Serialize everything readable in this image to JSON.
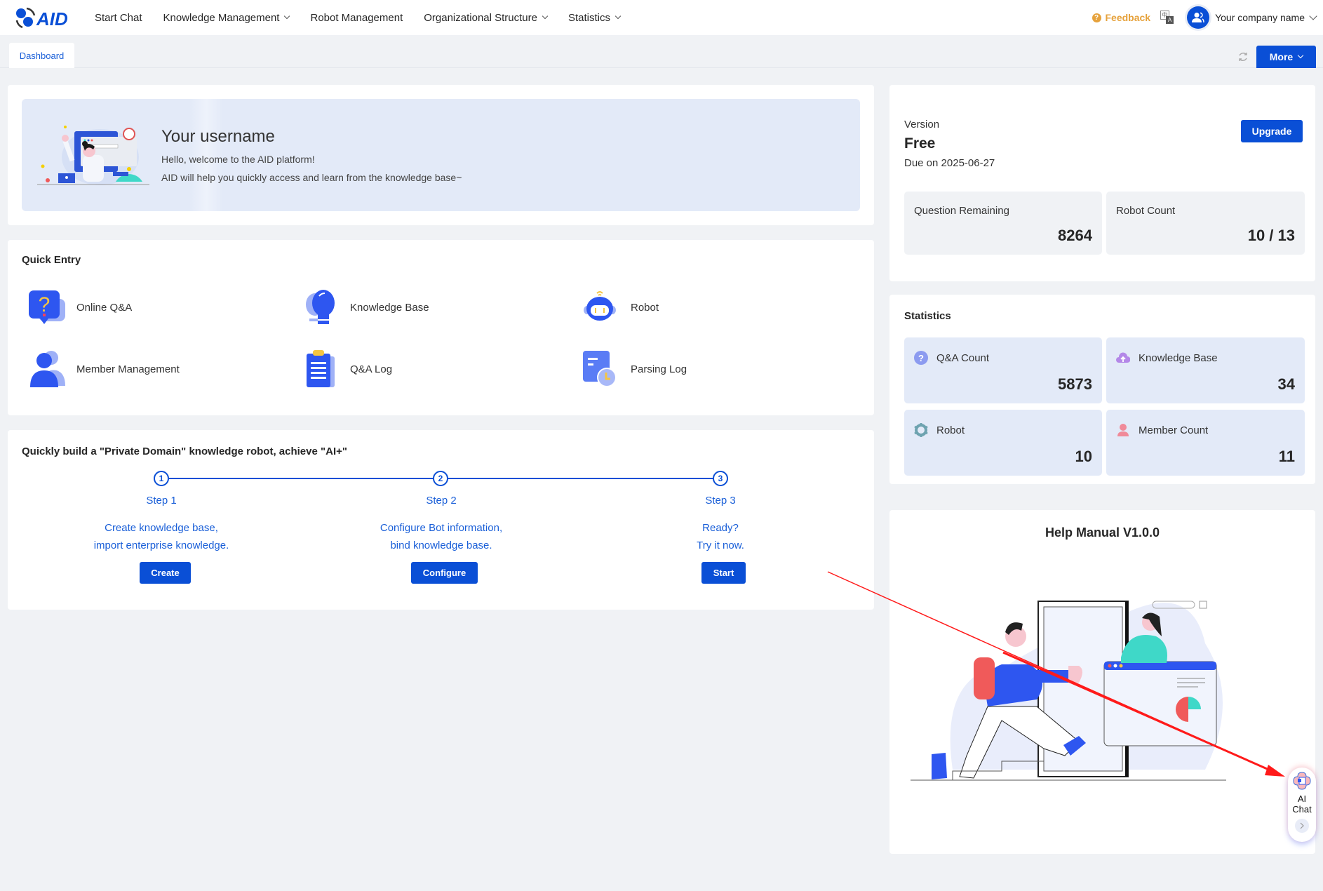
{
  "navbar": {
    "logo_text": "AID",
    "items": [
      {
        "label": "Start Chat",
        "dropdown": false
      },
      {
        "label": "Knowledge Management",
        "dropdown": true
      },
      {
        "label": "Robot Management",
        "dropdown": false
      },
      {
        "label": "Organizational Structure",
        "dropdown": true
      },
      {
        "label": "Statistics",
        "dropdown": true
      }
    ],
    "feedback_label": "Feedback",
    "lang_icon": {
      "zh": "中",
      "en": "A"
    },
    "company_name": "Your company name"
  },
  "tabs": {
    "items": [
      {
        "label": "Dashboard",
        "active": true
      }
    ],
    "more_label": "More"
  },
  "welcome": {
    "username": "Your username",
    "line1": "Hello, welcome to the AID platform!",
    "line2": "AID will help you quickly access and learn from the knowledge base~"
  },
  "quick_entry": {
    "title": "Quick Entry",
    "items": [
      {
        "label": "Online Q&A",
        "icon": "question-bubble-icon"
      },
      {
        "label": "Knowledge Base",
        "icon": "lightbulb-icon"
      },
      {
        "label": "Robot",
        "icon": "robot-icon"
      },
      {
        "label": "Member Management",
        "icon": "users-icon"
      },
      {
        "label": "Q&A Log",
        "icon": "clipboard-icon"
      },
      {
        "label": "Parsing Log",
        "icon": "document-clock-icon"
      }
    ]
  },
  "steps": {
    "title": "Quickly build a \"Private Domain\" knowledge robot, achieve \"AI+\"",
    "items": [
      {
        "num": "1",
        "title": "Step 1",
        "desc1": "Create knowledge base,",
        "desc2": "import enterprise knowledge.",
        "button": "Create"
      },
      {
        "num": "2",
        "title": "Step 2",
        "desc1": "Configure Bot information,",
        "desc2": "bind knowledge base.",
        "button": "Configure"
      },
      {
        "num": "3",
        "title": "Step 3",
        "desc1": "Ready?",
        "desc2": "Try it now.",
        "button": "Start"
      }
    ]
  },
  "version": {
    "label": "Version",
    "plan": "Free",
    "due": "Due on 2025-06-27",
    "upgrade_label": "Upgrade",
    "cards": [
      {
        "label": "Question Remaining",
        "value": "8264"
      },
      {
        "label": "Robot Count",
        "value": "10 / 13"
      }
    ]
  },
  "statistics": {
    "title": "Statistics",
    "cards": [
      {
        "label": "Q&A Count",
        "value": "5873",
        "icon": "question-circle-icon",
        "color": "#8c9bf0"
      },
      {
        "label": "Knowledge Base",
        "value": "34",
        "icon": "cloud-upload-icon",
        "color": "#b488e8"
      },
      {
        "label": "Robot",
        "value": "10",
        "icon": "gear-icon",
        "color": "#6ea3b0"
      },
      {
        "label": "Member Count",
        "value": "11",
        "icon": "user-icon",
        "color": "#f08a99"
      }
    ]
  },
  "help": {
    "title": "Help Manual V1.0.0"
  },
  "ai_chat": {
    "label": "AI Chat"
  },
  "colors": {
    "primary": "#0a4fd6",
    "feedback": "#e6a23c",
    "annotation_arrow": "#ff1a1a"
  }
}
